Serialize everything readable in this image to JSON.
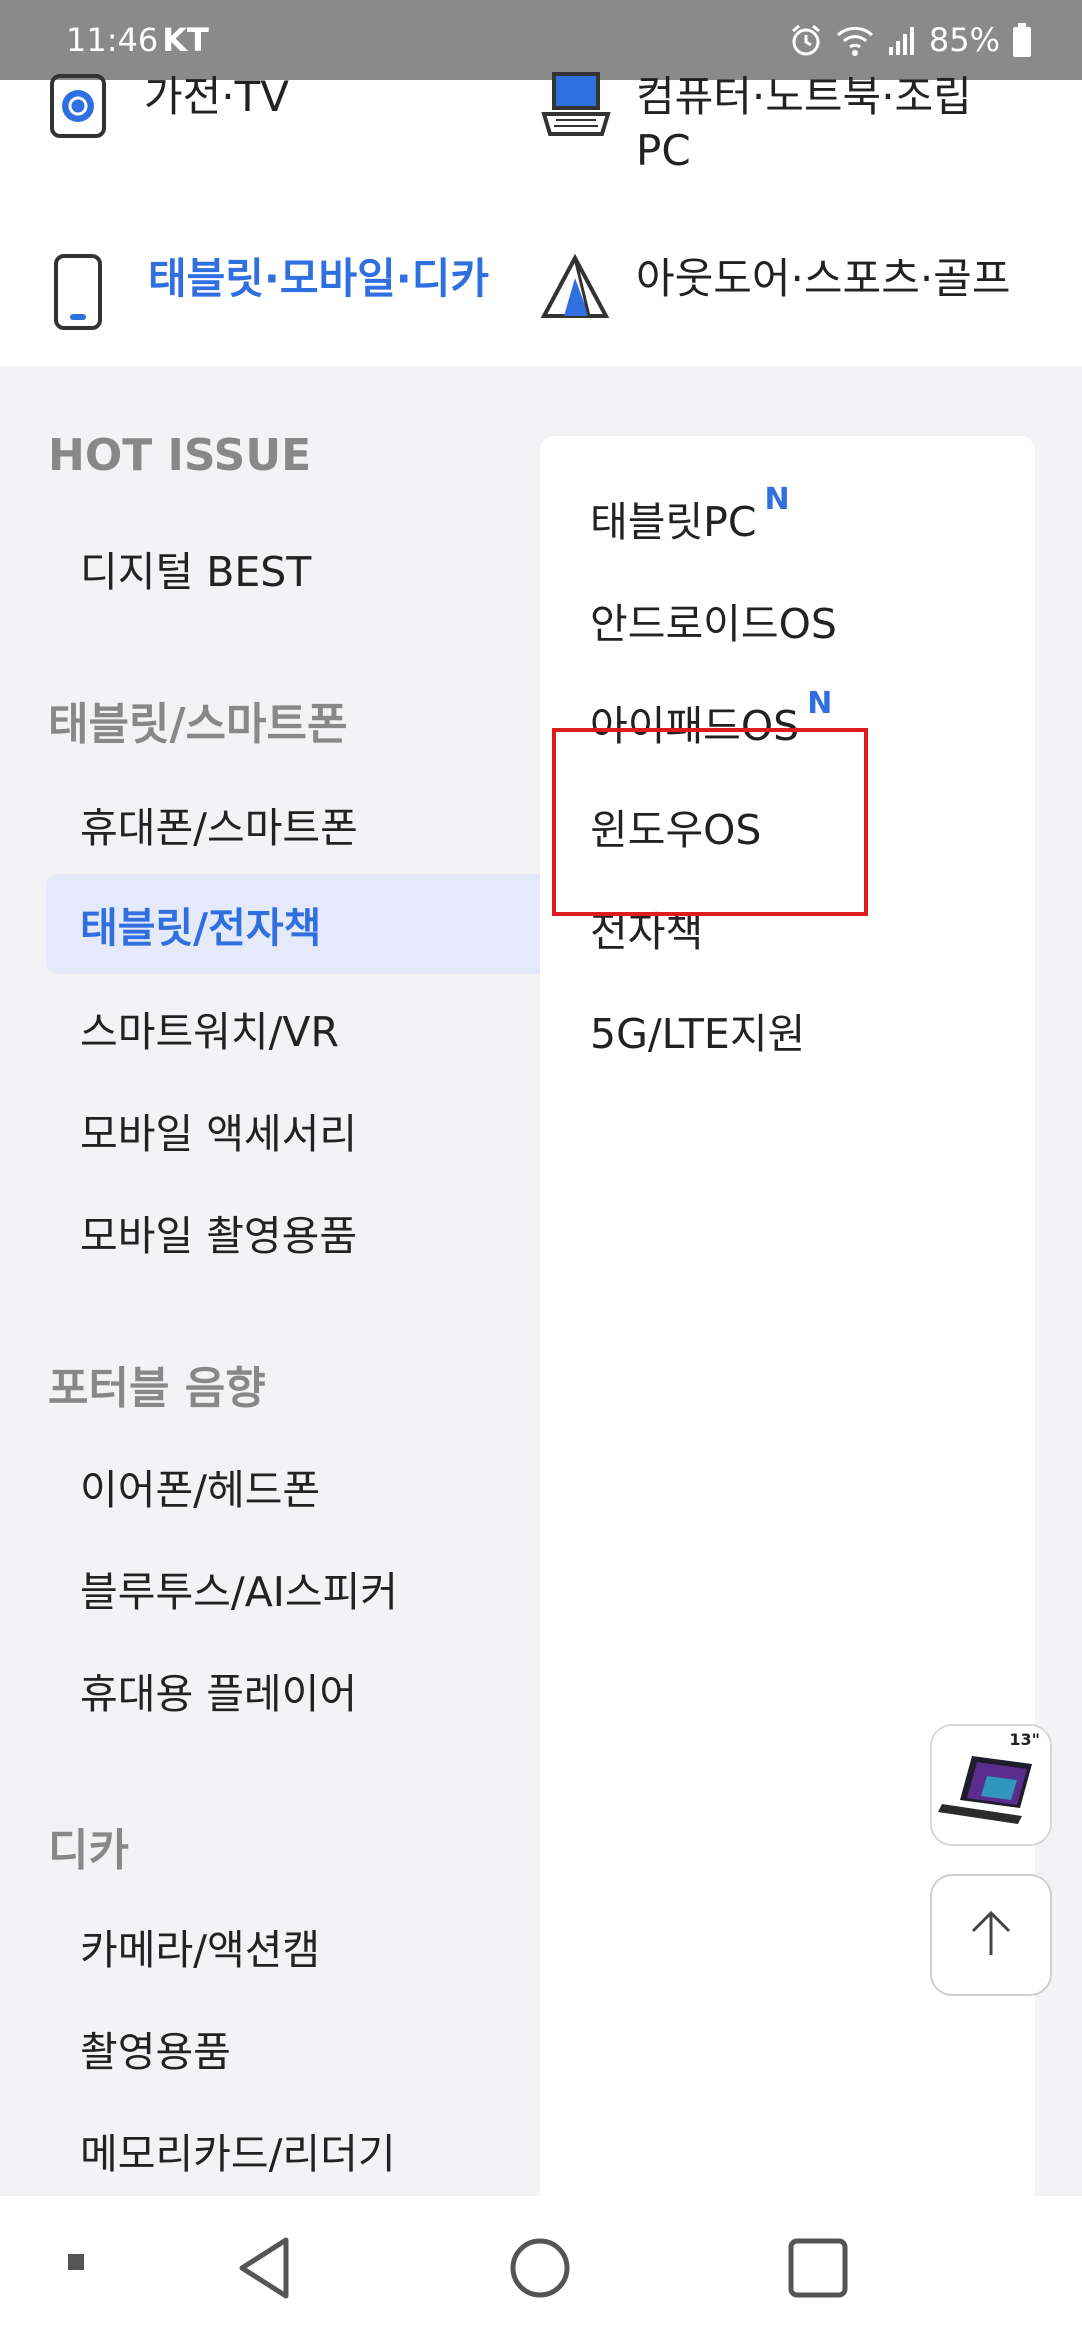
{
  "status_bar": {
    "time": "11:46",
    "carrier": "KT",
    "battery": "85%",
    "icons": [
      "alarm-icon",
      "wifi-icon",
      "signal-icon",
      "battery-icon"
    ]
  },
  "top_categories": [
    {
      "label": "가전·TV",
      "icon": "appliance-icon",
      "active": false
    },
    {
      "label": "컴퓨터·노트북·조립PC",
      "icon": "laptop-icon",
      "active": false
    },
    {
      "label": "태블릿·모바일·디카",
      "icon": "phone-icon",
      "active": true
    },
    {
      "label": "아웃도어·스포츠·골프",
      "icon": "tent-icon",
      "active": false
    }
  ],
  "left_menu": {
    "hot_issue": {
      "title": "HOT ISSUE",
      "items": [
        "디지털 BEST"
      ]
    },
    "tablet_smartphone": {
      "title": "태블릿/스마트폰",
      "items": [
        "휴대폰/스마트폰",
        "태블릿/전자책",
        "스마트워치/VR",
        "모바일 액세서리",
        "모바일 촬영용품"
      ],
      "active_item": "태블릿/전자책"
    },
    "portable_audio": {
      "title": "포터블 음향",
      "items": [
        "이어폰/헤드폰",
        "블루투스/AI스피커",
        "휴대용 플레이어"
      ]
    },
    "camera": {
      "title": "디카",
      "items": [
        "카메라/액션캠",
        "촬영용품",
        "메모리카드/리더기"
      ]
    }
  },
  "right_menu": [
    {
      "label": "태블릿PC",
      "badge": "N"
    },
    {
      "label": "안드로이드OS",
      "badge": ""
    },
    {
      "label": "아이패드OS",
      "badge": "N"
    },
    {
      "label": "윈도우OS",
      "badge": ""
    },
    {
      "label": "전자책",
      "badge": ""
    },
    {
      "label": "5G/LTE지원",
      "badge": ""
    }
  ],
  "highlight_color": "#e01b1b",
  "accent_color": "#2f6fe0",
  "floating": {
    "thumb_badge": "13\"",
    "top_icon": "arrow-up-icon"
  },
  "nav_bar": {
    "icons": [
      "recent-dot-icon",
      "back-icon",
      "home-icon",
      "overview-icon"
    ]
  }
}
